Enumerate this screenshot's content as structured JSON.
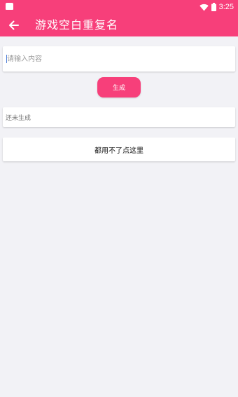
{
  "status_bar": {
    "time": "3:25"
  },
  "app_bar": {
    "title": "游戏空白重复名",
    "back_icon": "arrow-left-icon"
  },
  "input": {
    "placeholder": "请输入内容",
    "value": ""
  },
  "generate_button": {
    "label": "生成"
  },
  "result": {
    "text": "还未生成"
  },
  "copy_area": {
    "label": "都用不了点这里"
  },
  "colors": {
    "accent": "#f73f7a",
    "background": "#f2f2f6",
    "card": "#ffffff"
  }
}
